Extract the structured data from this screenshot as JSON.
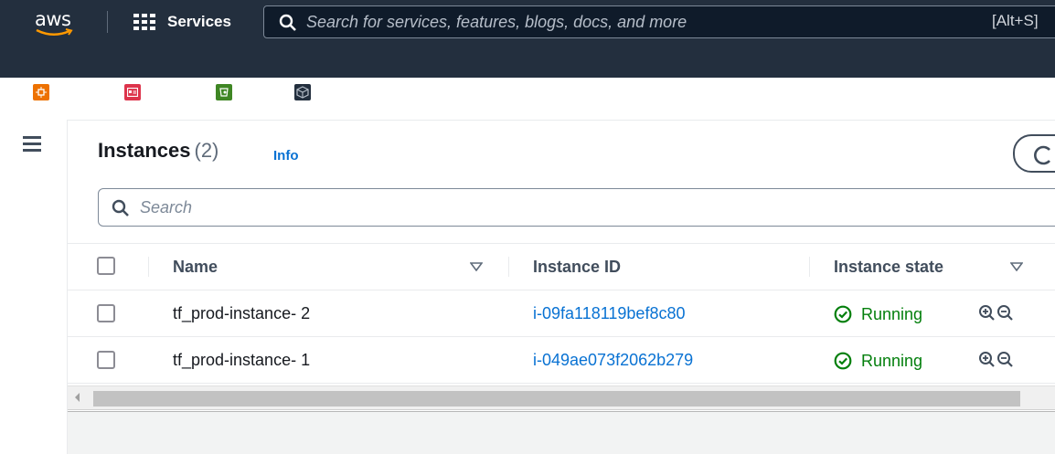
{
  "nav": {
    "logo_text": "aws",
    "services_label": "Services",
    "search_placeholder": "Search for services, features, blogs, docs, and more",
    "search_shortcut": "[Alt+S]",
    "favorites": [
      {
        "label": "EC2",
        "icon": "ec2-icon",
        "color": "#ed7100"
      },
      {
        "label": "IAM",
        "icon": "iam-icon",
        "color": "#dd344c"
      },
      {
        "label": "S3",
        "icon": "s3-icon",
        "color": "#3f8624"
      },
      {
        "label": "Console Home",
        "icon": "console-home-icon",
        "color": "#232f3e"
      }
    ]
  },
  "page": {
    "title": "Instances",
    "count": "(2)",
    "info_label": "Info",
    "filter_placeholder": "Search"
  },
  "table": {
    "columns": [
      "Name",
      "Instance ID",
      "Instance state"
    ],
    "rows": [
      {
        "name": "tf_prod-instance- 2",
        "instance_id": "i-09fa118119bef8c80",
        "state": "Running"
      },
      {
        "name": "tf_prod-instance- 1",
        "instance_id": "i-049ae073f2062b279",
        "state": "Running"
      }
    ]
  },
  "colors": {
    "nav_bg": "#232f3e",
    "link": "#0972d3",
    "running": "#037f0c"
  }
}
